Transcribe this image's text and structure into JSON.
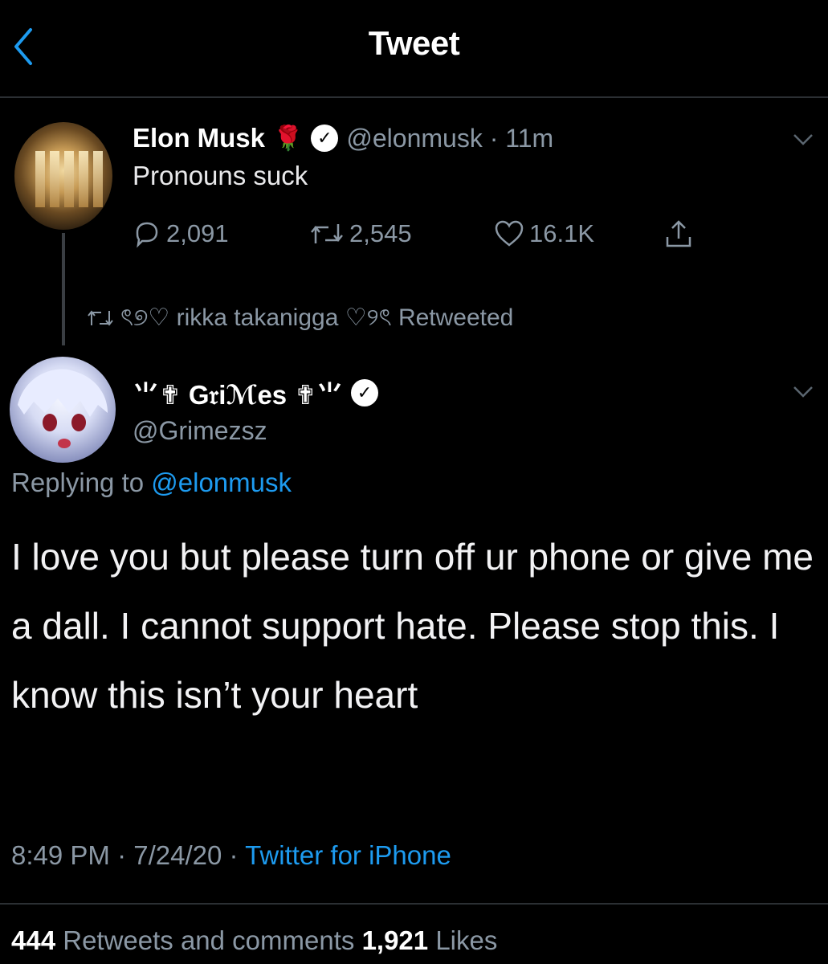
{
  "header": {
    "title": "Tweet",
    "back_icon": "chevron-left-icon"
  },
  "colors": {
    "background": "#000000",
    "accent": "#1d9bf0",
    "muted": "#8b98a5"
  },
  "quoted_tweet": {
    "name": "Elon Musk",
    "name_emoji": "🌹",
    "handle_time": "@elonmusk · 11m",
    "text": "Pronouns suck",
    "replies": "2,091",
    "retweets": "2,545",
    "likes": "16.1K"
  },
  "retweet_context": {
    "retweeter": "ৎ୭♡ rikka takanigga ♡୨ৎ Retweeted"
  },
  "tweet": {
    "name": "⺌✟ G𝔯iℳes ✟⺌",
    "handle": "@Grimezsz",
    "replying_prefix": "Replying to ",
    "replying_handle": "@elonmusk",
    "body": "I love you but please turn off ur phone or give me a dall.  I cannot support hate. Please stop this. I know this isn’t your heart",
    "time_date": "8:49 PM · 7/24/20 · ",
    "source": "Twitter for iPhone",
    "retweets_count": "444",
    "retweets_label": " Retweets and comments  ",
    "likes_count": "1,921",
    "likes_label": " Likes"
  }
}
